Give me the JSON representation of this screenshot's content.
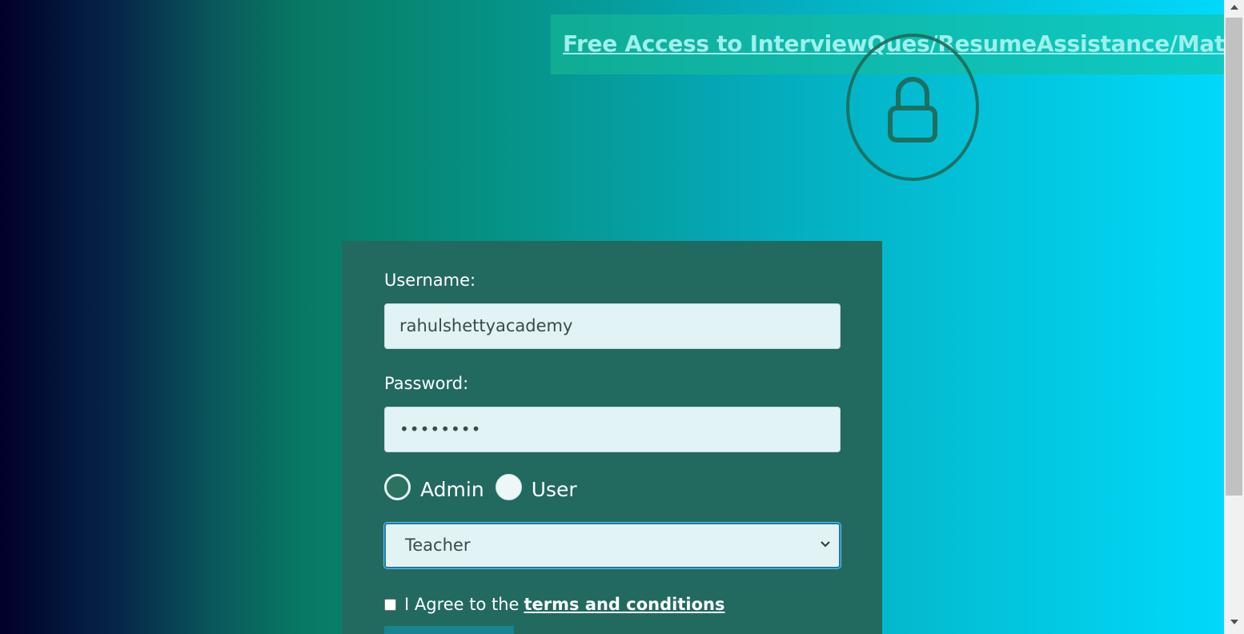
{
  "banner": {
    "link_text": "Free Access to InterviewQues/ResumeAssistance/Material"
  },
  "icons": {
    "lock": "lock-icon",
    "select_chevron": "chevron-down-icon"
  },
  "form": {
    "username_label": "Username:",
    "username_value": "rahulshettyacademy",
    "password_label": "Password:",
    "password_value": "••••••••",
    "radio_admin_label": "Admin",
    "radio_user_label": "User",
    "selected_role": "Admin",
    "select_value": "Teacher",
    "agree_text": "I Agree to the",
    "terms_link": "terms and conditions",
    "agree_checked": false
  },
  "colors": {
    "card_background": "#226960",
    "banner_link": "#9ef0ec",
    "select_focus_border": "#1a7aa8",
    "signin_button": "#178590"
  }
}
